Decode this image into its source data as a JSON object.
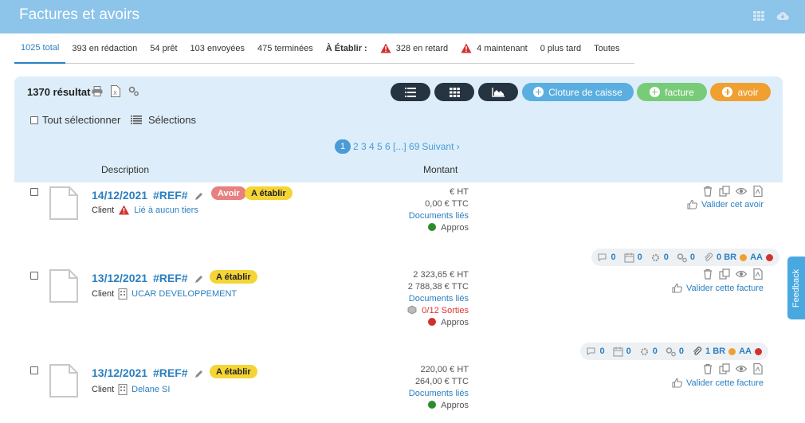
{
  "header": {
    "title": "Factures et avoirs"
  },
  "tabs": [
    {
      "label": "1025 total"
    },
    {
      "label": "393 en rédaction"
    },
    {
      "label": "54 prêt"
    },
    {
      "label": "103 envoyées"
    },
    {
      "label": "475 terminées"
    },
    {
      "label": "À Établir :"
    },
    {
      "label": "328 en retard"
    },
    {
      "label": "4 maintenant"
    },
    {
      "label": "0 plus tard"
    },
    {
      "label": "Toutes"
    }
  ],
  "toolbar": {
    "result_count": "1370 résultat",
    "cloture_label": "Cloture de caisse",
    "facture_label": "facture",
    "avoir_label": "avoir",
    "select_all_label": "Tout sélectionner",
    "selections_label": "Sélections"
  },
  "pagination": {
    "current": "1",
    "pages": "2 3 4 5 6 [...] 69",
    "next": "Suivant ›"
  },
  "columns": {
    "description": "Description",
    "amount": "Montant"
  },
  "rows": [
    {
      "date": "14/12/2021",
      "ref": "#REF#",
      "badge1": "Avoir",
      "badge2": "A établir",
      "client_prefix": "Client",
      "client": "Lié à aucun tiers",
      "ht": "€ HT",
      "ttc": "0,00 € TTC",
      "docs": "Documents liés",
      "status": "Appros",
      "validate": "Valider cet avoir"
    },
    {
      "date": "13/12/2021",
      "ref": "#REF#",
      "badge": "A établir",
      "client_prefix": "Client",
      "client": "UCAR DEVELOPPEMENT",
      "ht": "2 323,65 € HT",
      "ttc": "2 788,38 € TTC",
      "docs": "Documents liés",
      "sorties": "0/12 Sorties",
      "status": "Appros",
      "validate": "Valider cette facture",
      "meta": {
        "comments": "0",
        "calendar": "0",
        "tasks": "0",
        "workflow": "0",
        "br": "0 BR",
        "aa": "AA"
      }
    },
    {
      "date": "13/12/2021",
      "ref": "#REF#",
      "badge": "A établir",
      "client_prefix": "Client",
      "client": "Delane SI",
      "ht": "220,00 € HT",
      "ttc": "264,00 € TTC",
      "docs": "Documents liés",
      "status": "Appros",
      "validate": "Valider cette facture",
      "meta": {
        "comments": "0",
        "calendar": "0",
        "tasks": "0",
        "workflow": "0",
        "br": "1 BR",
        "aa": "AA"
      }
    }
  ],
  "feedback": {
    "label": "Feedback"
  },
  "colors": {
    "header": "#8cc4ea",
    "link": "#2a7fc0",
    "green_dot": "#2e8b2e",
    "red_dot": "#d33030",
    "orange_dot": "#f0a030"
  }
}
